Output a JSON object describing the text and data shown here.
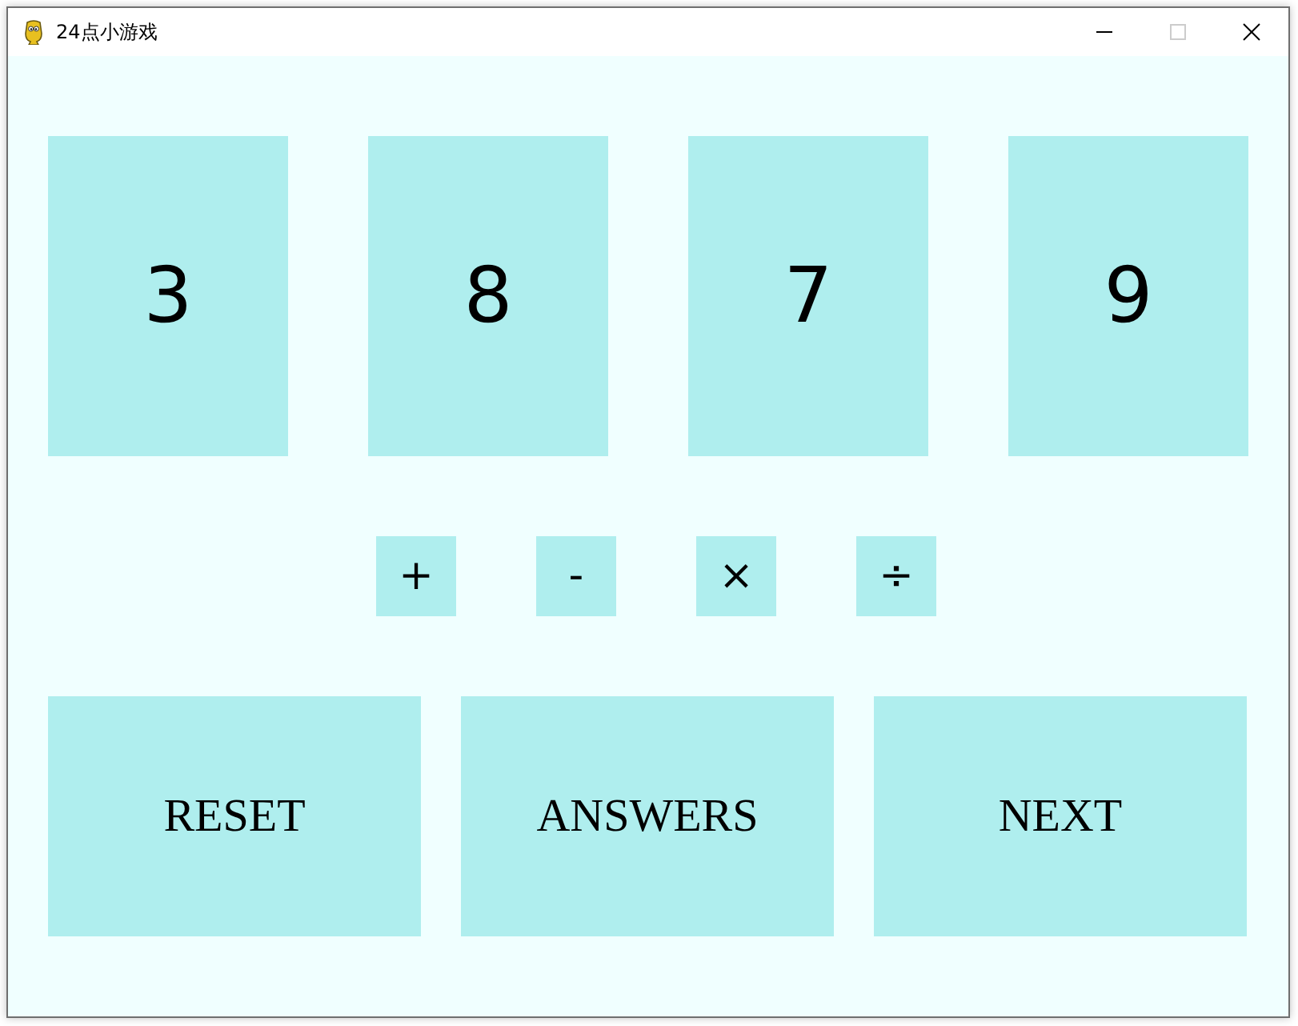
{
  "window": {
    "title": "24点小游戏",
    "controls": [
      {
        "kind": "minimize",
        "disabled": false
      },
      {
        "kind": "maximize",
        "disabled": true
      },
      {
        "kind": "close",
        "disabled": false
      }
    ]
  },
  "cards": [
    "3",
    "8",
    "7",
    "9"
  ],
  "operators": [
    "+",
    "-",
    "×",
    "÷"
  ],
  "buttons": [
    "RESET",
    "ANSWERS",
    "NEXT"
  ]
}
